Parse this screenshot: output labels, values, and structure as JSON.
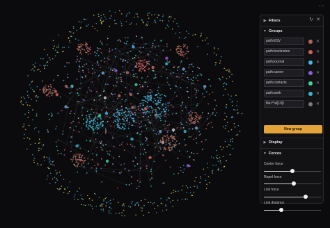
{
  "top_icon": "⋯",
  "panel": {
    "filters_label": "Filters",
    "groups_label": "Groups",
    "groups": [
      {
        "query": "path:ESV",
        "color": "#b06a5c"
      },
      {
        "query": "path:booknotes",
        "color": "#d46060"
      },
      {
        "query": "path:journal",
        "color": "#40b8e0"
      },
      {
        "query": "path:career",
        "color": "#8e5fd6"
      },
      {
        "query": "path:contacts",
        "color": "#3ad99a"
      },
      {
        "query": "path:work",
        "color": "#35b7cf"
      },
      {
        "query": "file:/^\\d{10}/",
        "color": "#7a7a84"
      }
    ],
    "new_group_label": "New group",
    "display_label": "Display",
    "forces_label": "Forces",
    "forces": [
      {
        "label": "Center force",
        "value": 0.5
      },
      {
        "label": "Repel force",
        "value": 0.52
      },
      {
        "label": "Link force",
        "value": 0.73
      },
      {
        "label": "Link distance",
        "value": 0.31
      }
    ]
  }
}
